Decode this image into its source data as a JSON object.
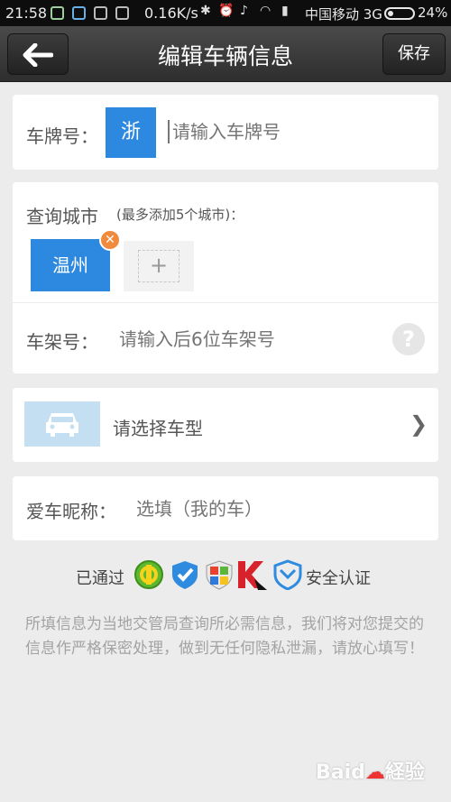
{
  "status_bar": {
    "time": "21:58",
    "speed": "0.16K/s",
    "carrier": "中国移动 3G",
    "battery": "24%"
  },
  "header": {
    "title": "编辑车辆信息",
    "back_icon": "arrow-left-icon",
    "save_label": "保存"
  },
  "plate": {
    "label": "车牌号：",
    "province": "浙",
    "placeholder": "请输入车牌号"
  },
  "city": {
    "label": "查询城市",
    "hint": "(最多添加5个城市)：",
    "chips": [
      "温州"
    ],
    "add_icon": "plus-icon"
  },
  "frame": {
    "label": "车架号：",
    "placeholder": "请输入后6位车架号",
    "help_icon": "question-icon"
  },
  "car_type": {
    "icon": "car-icon",
    "label": "请选择车型"
  },
  "nickname": {
    "label": "爱车昵称：",
    "placeholder": "选填（我的车）"
  },
  "security": {
    "prefix": "已通过",
    "suffix": "安全认证",
    "badges": [
      "360-icon",
      "shield-check-icon",
      "windows-shield-icon",
      "kaspersky-icon",
      "tencent-shield-icon"
    ]
  },
  "note": "所填信息为当地交管局查询所必需信息，我们将对您提交的信息作严格保密处理，做到无任何隐私泄漏，请放心填写！",
  "watermark": "Bai経验",
  "colors": {
    "accent": "#2d89e0",
    "remove": "#f08a3c",
    "background": "#ececec"
  }
}
